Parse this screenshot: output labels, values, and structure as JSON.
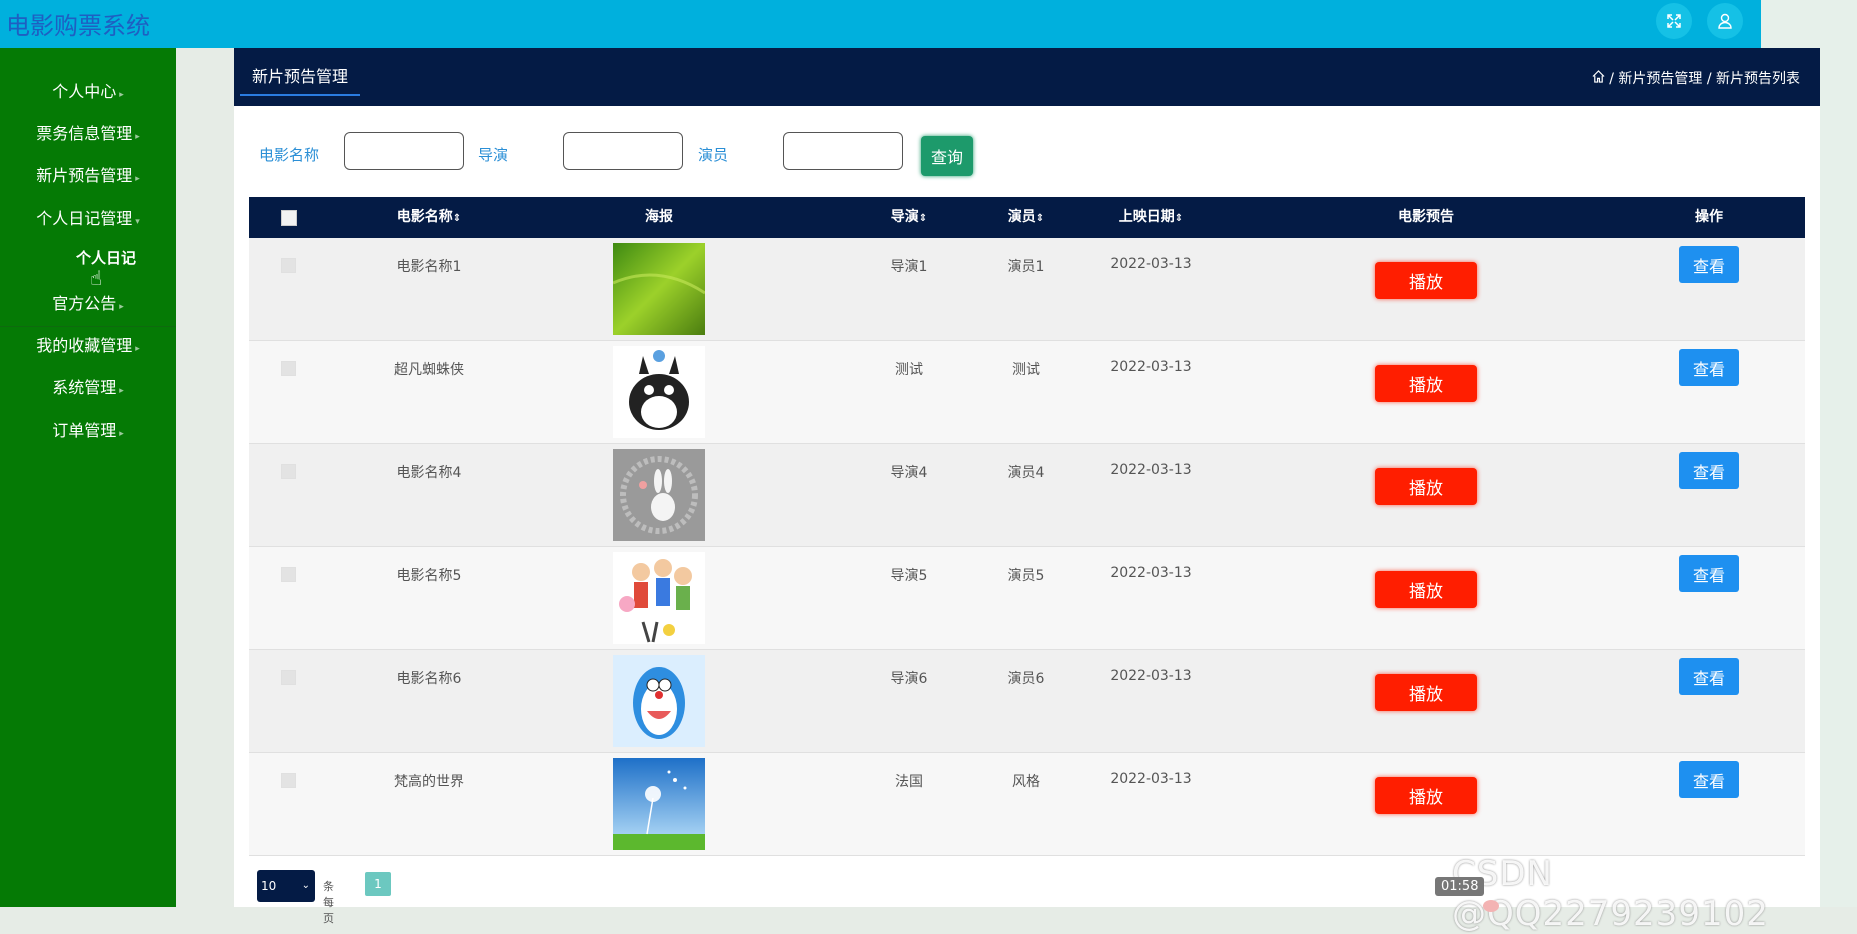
{
  "app": {
    "title": "电影购票系统"
  },
  "topbar": {
    "fullscreen_icon": "expand-icon",
    "user_icon": "user-icon"
  },
  "sidebar": {
    "items": [
      {
        "label": "个人中心"
      },
      {
        "label": "票务信息管理"
      },
      {
        "label": "新片预告管理"
      },
      {
        "label": "个人日记管理"
      },
      {
        "label": "个人日记"
      },
      {
        "label": "官方公告"
      },
      {
        "label": "我的收藏管理"
      },
      {
        "label": "系统管理"
      },
      {
        "label": "订单管理"
      }
    ]
  },
  "header": {
    "tab": "新片预告管理",
    "breadcrumb": {
      "home_icon": "home-icon",
      "path": "/ 新片预告管理 / 新片预告列表"
    }
  },
  "search": {
    "name_label": "电影名称",
    "director_label": "导演",
    "actor_label": "演员",
    "name_value": "",
    "director_value": "",
    "actor_value": "",
    "button": "查询"
  },
  "table": {
    "columns": [
      "电影名称",
      "海报",
      "导演",
      "演员",
      "上映日期",
      "电影预告",
      "操作"
    ],
    "sortable_mark": "⇕",
    "play_label": "播放",
    "view_label": "查看",
    "rows": [
      {
        "name": "电影名称1",
        "director": "导演1",
        "actor": "演员1",
        "date": "2022-03-13",
        "poster": "grass-field"
      },
      {
        "name": "超凡蜘蛛侠",
        "director": "测试",
        "actor": "测试",
        "date": "2022-03-13",
        "poster": "totoro"
      },
      {
        "name": "电影名称4",
        "director": "导演4",
        "actor": "演员4",
        "date": "2022-03-13",
        "poster": "bunny"
      },
      {
        "name": "电影名称5",
        "director": "导演5",
        "actor": "演员5",
        "date": "2022-03-13",
        "poster": "cartoon-kids"
      },
      {
        "name": "电影名称6",
        "director": "导演6",
        "actor": "演员6",
        "date": "2022-03-13",
        "poster": "doraemon"
      },
      {
        "name": "梵高的世界",
        "director": "法国",
        "actor": "风格",
        "date": "2022-03-13",
        "poster": "dandelion-sky"
      }
    ]
  },
  "pagination": {
    "page_size": "10",
    "per_page_label": "条每页",
    "current_page": "1"
  },
  "overlay": {
    "watermark": "CSDN @QQ2279239102",
    "timer": "01:58"
  },
  "colors": {
    "topbar": "#00b0dd",
    "sidebar": "#057a05",
    "header": "#041b45",
    "play": "#ff1e00",
    "view": "#1e90f0",
    "search_btn": "#1d9a6b"
  }
}
